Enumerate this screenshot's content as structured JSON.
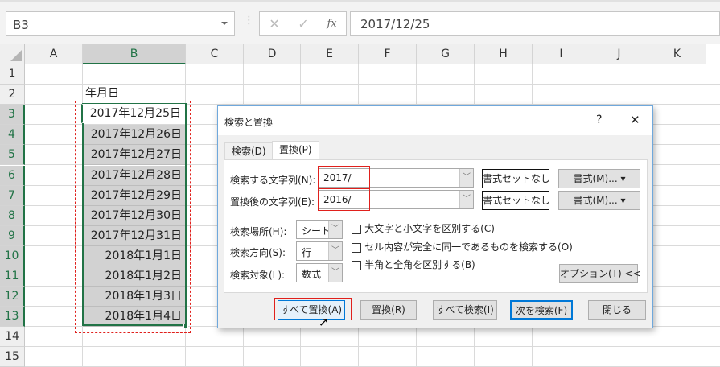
{
  "formula_bar": {
    "name_box": "B3",
    "cancel_icon": "✕",
    "enter_icon": "✓",
    "fx_label": "fx",
    "formula": "2017/12/25"
  },
  "columns": [
    "A",
    "B",
    "C",
    "D",
    "E",
    "F",
    "G",
    "H",
    "I",
    "J",
    "K"
  ],
  "rows": [
    "1",
    "2",
    "3",
    "4",
    "5",
    "6",
    "7",
    "8",
    "9",
    "10",
    "11",
    "12",
    "13",
    "14",
    "15"
  ],
  "cells": {
    "B2": "年月日",
    "B_dates": [
      "2017年12月25日",
      "2017年12月26日",
      "2017年12月27日",
      "2017年12月28日",
      "2017年12月29日",
      "2017年12月30日",
      "2017年12月31日",
      "2018年1月1日",
      "2018年1月2日",
      "2018年1月3日",
      "2018年1月4日"
    ]
  },
  "dialog": {
    "title": "検索と置換",
    "help": "?",
    "close": "✕",
    "tabs": [
      "検索(D)",
      "置換(P)"
    ],
    "find_label": "検索する文字列(N):",
    "find_value": "2017/",
    "replace_label": "置換後の文字列(E):",
    "replace_value": "2016/",
    "no_format": "書式セットなし",
    "format_button": "書式(M)...",
    "within_label": "検索場所(H):",
    "within_value": "シート",
    "search_label": "検索方向(S):",
    "search_value": "行",
    "lookin_label": "検索対象(L):",
    "lookin_value": "数式",
    "options": [
      "大文字と小文字を区別する(C)",
      "セル内容が完全に同一であるものを検索する(O)",
      "半角と全角を区別する(B)"
    ],
    "options_button": "オプション(T) <<",
    "buttons": {
      "replace_all": "すべて置換(A)",
      "replace": "置換(R)",
      "find_all": "すべて検索(I)",
      "find_next": "次を検索(F)",
      "close": "閉じる"
    }
  }
}
